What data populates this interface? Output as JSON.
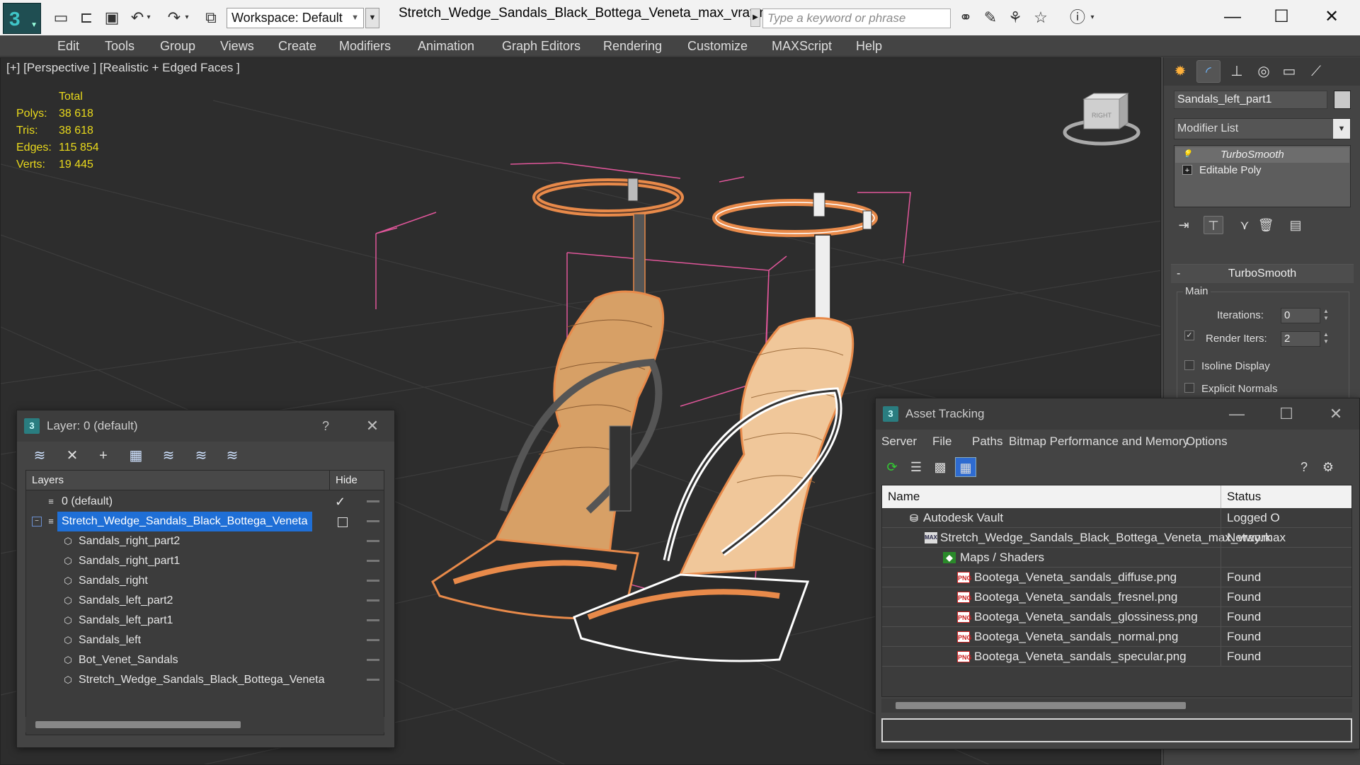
{
  "titlebar": {
    "workspace": "Workspace: Default",
    "file_title": "Stretch_Wedge_Sandals_Black_Bottega_Veneta_max_vray.max",
    "search_placeholder": "Type a keyword or phrase",
    "minimize": "—",
    "maximize": "☐",
    "close": "✕"
  },
  "menu": [
    "Edit",
    "Tools",
    "Group",
    "Views",
    "Create",
    "Modifiers",
    "Animation",
    "Graph Editors",
    "Rendering",
    "Customize",
    "MAXScript",
    "Help"
  ],
  "viewport": {
    "label": "[+] [Perspective ] [Realistic + Edged Faces ]",
    "stats": {
      "header": "Total",
      "polys_label": "Polys:",
      "polys": "38 618",
      "tris_label": "Tris:",
      "tris": "38 618",
      "edges_label": "Edges:",
      "edges": "115 854",
      "verts_label": "Verts:",
      "verts": "19 445"
    },
    "viewcube_label": "RIGHT"
  },
  "command_panel": {
    "object_name": "Sandals_left_part1",
    "modifier_list": "Modifier List",
    "stack": [
      "TurboSmooth",
      "Editable Poly"
    ],
    "rollout_title": "TurboSmooth",
    "group_main": "Main",
    "iterations_label": "Iterations:",
    "iterations_value": "0",
    "render_iters_label": "Render Iters:",
    "render_iters_value": "2",
    "render_iters_checked": true,
    "isoline_label": "Isoline Display",
    "explicit_normals_label": "Explicit Normals"
  },
  "layer_window": {
    "title": "Layer: 0 (default)",
    "help": "?",
    "close": "✕",
    "col_layers": "Layers",
    "col_hide": "Hide",
    "rows": [
      {
        "name": "0 (default)",
        "indent": 0
      },
      {
        "name": "Stretch_Wedge_Sandals_Black_Bottega_Veneta",
        "indent": 0
      },
      {
        "name": "Sandals_right_part2",
        "indent": 1
      },
      {
        "name": "Sandals_right_part1",
        "indent": 1
      },
      {
        "name": "Sandals_right",
        "indent": 1
      },
      {
        "name": "Sandals_left_part2",
        "indent": 1
      },
      {
        "name": "Sandals_left_part1",
        "indent": 1
      },
      {
        "name": "Sandals_left",
        "indent": 1
      },
      {
        "name": "Bot_Venet_Sandals",
        "indent": 1
      },
      {
        "name": "Stretch_Wedge_Sandals_Black_Bottega_Veneta",
        "indent": 1
      }
    ]
  },
  "asset_window": {
    "title": "Asset Tracking",
    "menu": [
      "Server",
      "File",
      "Paths",
      "Bitmap Performance and Memory",
      "Options"
    ],
    "col_name": "Name",
    "col_status": "Status",
    "rows": [
      {
        "name": "Autodesk Vault",
        "status": "Logged O",
        "icon": "vault"
      },
      {
        "name": "Stretch_Wedge_Sandals_Black_Bottega_Veneta_max_vray.max",
        "status": "Network",
        "icon": "max"
      },
      {
        "name": "Maps / Shaders",
        "status": "",
        "icon": "maps"
      },
      {
        "name": "Bootega_Veneta_sandals_diffuse.png",
        "status": "Found",
        "icon": "png"
      },
      {
        "name": "Bootega_Veneta_sandals_fresnel.png",
        "status": "Found",
        "icon": "png"
      },
      {
        "name": "Bootega_Veneta_sandals_glossiness.png",
        "status": "Found",
        "icon": "png"
      },
      {
        "name": "Bootega_Veneta_sandals_normal.png",
        "status": "Found",
        "icon": "png"
      },
      {
        "name": "Bootega_Veneta_sandals_specular.png",
        "status": "Found",
        "icon": "png"
      }
    ],
    "minimize": "—",
    "maximize": "☐",
    "close": "✕"
  },
  "colors": {
    "selection_blue": "#1f6fd6",
    "wire_orange": "#e88a4a",
    "bbox_pink": "#e0569a",
    "stats_yellow": "#e9d91c"
  }
}
